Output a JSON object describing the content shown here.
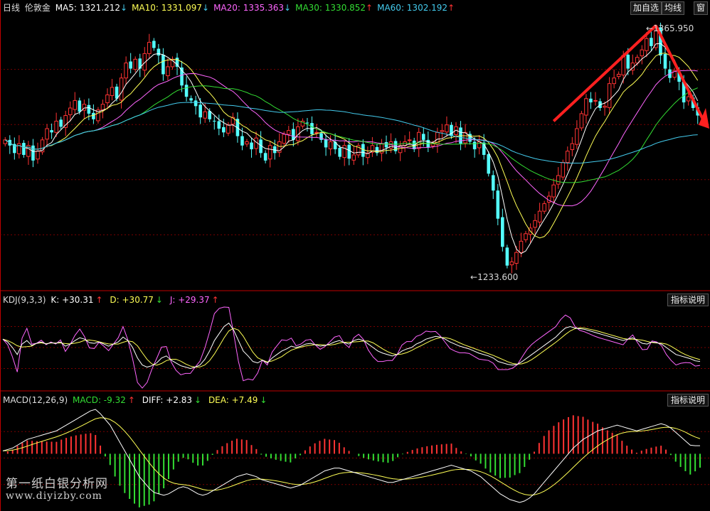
{
  "header": {
    "period": "日线",
    "symbol": "伦敦金",
    "ma": [
      {
        "label": "MA5: 1321.212",
        "arrow": "↓",
        "color": "#ffffff"
      },
      {
        "label": "MA10: 1331.097",
        "arrow": "↓",
        "color": "#ffff55"
      },
      {
        "label": "MA20: 1335.363",
        "arrow": "↓",
        "color": "#ff66ff"
      },
      {
        "label": "MA30: 1330.852",
        "arrow": "↑",
        "color": "#33dd33"
      },
      {
        "label": "MA60: 1302.192",
        "arrow": "↑",
        "color": "#44ccee"
      }
    ],
    "buttons": {
      "add": "加自选",
      "avg": "均线",
      "win": "窗"
    }
  },
  "price_panel": {
    "high_label": "1365.950",
    "low_label": "1233.600"
  },
  "kdj": {
    "title": "KDJ(9,3,3)",
    "k": "K: +30.31",
    "k_arrow": "↑",
    "d": "D: +30.77",
    "d_arrow": "↓",
    "j": "J: +29.37",
    "j_arrow": "↑",
    "help": "指标说明"
  },
  "macd": {
    "title": "MACD(12,26,9)",
    "macd": "MACD: -9.32",
    "macd_arrow": "↑",
    "diff": "DIFF: +2.83",
    "diff_arrow": "↓",
    "dea": "DEA: +7.49",
    "dea_arrow": "↓",
    "help": "指标说明"
  },
  "watermark": {
    "line1": "第一纸白银分析网",
    "line2": "www.diyizby.com"
  },
  "colors": {
    "up": "#ff3333",
    "down": "#54ffff",
    "grid": "#7a0000",
    "ma5": "#ffffff",
    "ma10": "#ffff55",
    "ma20": "#ff66ff",
    "ma30": "#33dd33",
    "ma60": "#44ccee",
    "arrow": "#ff2020"
  },
  "chart_data": {
    "type": "line",
    "price": {
      "ylim": [
        1225,
        1372
      ],
      "high": 1365.95,
      "low": 1233.6,
      "close": [
        1305,
        1302,
        1298,
        1303,
        1297,
        1302,
        1294,
        1299,
        1305,
        1311,
        1309,
        1315,
        1312,
        1318,
        1322,
        1326,
        1320,
        1324,
        1319,
        1316,
        1321,
        1324,
        1329,
        1333,
        1327,
        1338,
        1346,
        1343,
        1348,
        1343,
        1351,
        1357,
        1354,
        1350,
        1340,
        1344,
        1348,
        1344,
        1334,
        1328,
        1326,
        1323,
        1317,
        1320,
        1316,
        1315,
        1311,
        1309,
        1313,
        1317,
        1307,
        1302,
        1304,
        1300,
        1306,
        1298,
        1294,
        1302,
        1298,
        1304,
        1308,
        1310,
        1305,
        1312,
        1315,
        1314,
        1308,
        1309,
        1305,
        1301,
        1304,
        1300,
        1296,
        1302,
        1295,
        1297,
        1302,
        1296,
        1298,
        1302,
        1298,
        1303,
        1301,
        1304,
        1299,
        1302,
        1304,
        1305,
        1300,
        1309,
        1305,
        1301,
        1303,
        1309,
        1310,
        1313,
        1307,
        1312,
        1303,
        1309,
        1304,
        1300,
        1304,
        1297,
        1287,
        1278,
        1263,
        1248,
        1238,
        1240,
        1245,
        1251,
        1255,
        1258,
        1262,
        1267,
        1271,
        1275,
        1281,
        1286,
        1293,
        1299,
        1303,
        1311,
        1319,
        1327,
        1325,
        1326,
        1322,
        1323,
        1335,
        1338,
        1340,
        1350,
        1343,
        1346,
        1349,
        1353,
        1359,
        1355,
        1365,
        1350,
        1343,
        1338,
        1342,
        1336,
        1325,
        1328,
        1322,
        1318
      ]
    },
    "kdj": {
      "ylim": [
        -10,
        110
      ],
      "k": [
        62,
        58,
        50,
        40,
        55,
        60,
        53,
        56,
        58,
        55,
        57,
        56,
        58,
        52,
        55,
        60,
        64,
        62,
        57,
        56,
        58,
        55,
        52,
        55,
        58,
        65,
        60,
        50,
        35,
        25,
        22,
        24,
        28,
        35,
        38,
        32,
        28,
        24,
        22,
        20,
        22,
        25,
        33,
        45,
        60,
        70,
        80,
        85,
        75,
        60,
        45,
        38,
        30,
        28,
        32,
        28,
        35,
        40,
        45,
        48,
        52,
        50,
        52,
        55,
        56,
        54,
        52,
        53,
        55,
        58,
        60,
        57,
        55,
        60,
        62,
        60,
        55,
        50,
        45,
        42,
        40,
        38,
        40,
        45,
        48,
        50,
        55,
        58,
        62,
        64,
        66,
        65,
        62,
        58,
        55,
        52,
        50,
        48,
        45,
        42,
        40,
        38,
        35,
        30,
        28,
        26,
        25,
        26,
        30,
        35,
        40,
        45,
        50,
        55,
        60,
        65,
        72,
        78,
        80,
        78,
        77,
        76,
        74,
        72,
        70,
        68,
        66,
        64,
        62,
        60,
        62,
        64,
        60,
        56,
        55,
        58,
        57,
        55,
        50,
        45,
        40,
        38,
        36,
        34,
        31,
        30
      ]
    },
    "macd": {
      "ylim": [
        -20,
        17
      ],
      "diff": [
        1,
        1.5,
        2,
        3,
        4,
        5,
        5.5,
        6,
        6.5,
        7,
        7.5,
        8,
        9,
        10,
        11,
        12,
        13,
        14,
        15,
        15.5,
        14,
        12,
        10,
        7,
        4,
        1,
        -2,
        -5,
        -8,
        -10,
        -12,
        -13.5,
        -14,
        -14.5,
        -14,
        -13,
        -12,
        -11.5,
        -12,
        -13,
        -14,
        -14.5,
        -14,
        -13,
        -12,
        -11,
        -10,
        -9,
        -8,
        -7.5,
        -7,
        -7.5,
        -8,
        -9,
        -9.5,
        -10,
        -10.5,
        -11,
        -11.5,
        -12,
        -11.5,
        -11,
        -10,
        -9,
        -8,
        -7,
        -6,
        -5.5,
        -5,
        -5,
        -5.5,
        -6,
        -6.5,
        -7,
        -7.5,
        -8,
        -8.5,
        -9,
        -9.5,
        -10,
        -10,
        -9.5,
        -9,
        -8.5,
        -8,
        -7.5,
        -7,
        -6.5,
        -6,
        -5.5,
        -5,
        -4.5,
        -4,
        -4.5,
        -5,
        -5.5,
        -6,
        -7,
        -8,
        -9.5,
        -11,
        -12.5,
        -14,
        -15,
        -16,
        -16.5,
        -17,
        -16.5,
        -15.5,
        -14,
        -12,
        -10,
        -8,
        -6,
        -4,
        -2,
        0,
        2,
        3.5,
        5,
        6,
        7,
        8,
        8.5,
        9,
        9.5,
        10,
        9.5,
        9,
        8.5,
        8,
        8.5,
        9,
        9.5,
        10,
        10.5,
        10,
        9,
        7.5,
        6,
        4.5,
        3,
        2.8,
        2.83
      ]
    }
  }
}
